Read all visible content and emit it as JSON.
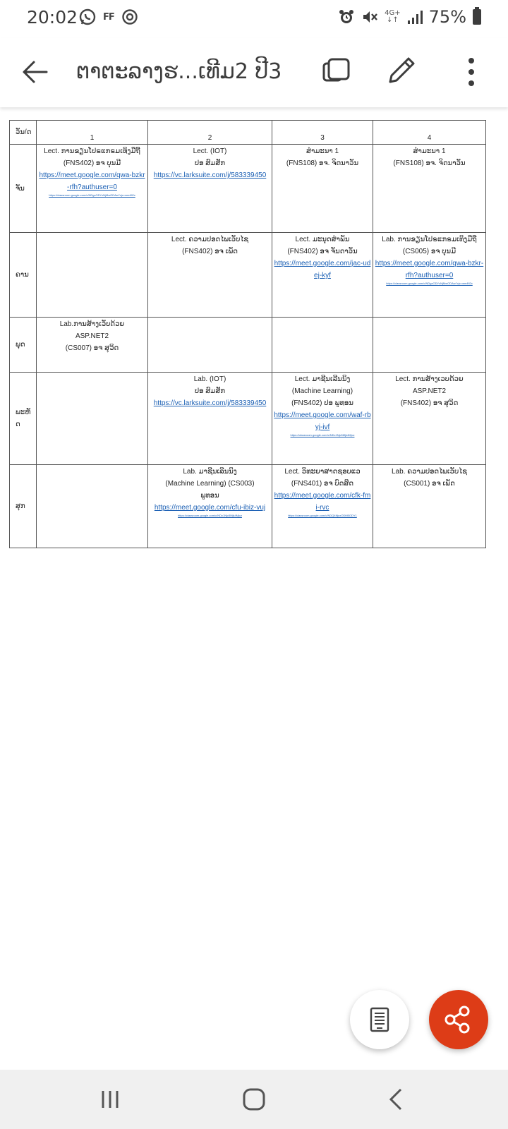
{
  "status_bar": {
    "time": "20:02",
    "ff_label": "FF",
    "network": "4G+",
    "battery": "75%",
    "icons": [
      "whatsapp-icon",
      "ff-icon",
      "sync-icon",
      "alarm-icon",
      "mute-icon",
      "signal-icon",
      "battery-icon"
    ]
  },
  "toolbar": {
    "title": "ຕາຕະລາງຮ...ເທີມ2 ປີ3",
    "icons": [
      "back-arrow-icon",
      "copy-icon",
      "edit-pencil-icon",
      "more-vert-icon"
    ]
  },
  "schedule": {
    "header": {
      "corner": "ວັນ/ດ",
      "periods": [
        "1",
        "2",
        "3",
        "4"
      ]
    },
    "rows": [
      {
        "day": "ຈັນ",
        "cells": [
          {
            "lines": [
              "Lect. ການຂຽນໂປຣແກຣມເທິງມືຖື",
              "(FNS402) ອຈ ບຸນມີ"
            ],
            "links": [
              "https://meet.google.com/qwa-bzkr-rfh?authuser=0"
            ],
            "tiny": [
              "https://classroom.google.com/c/NDgxODYzNjMwODAw?cjc=wm4fi2x"
            ]
          },
          {
            "lines": [
              "Lect. (IOT)",
              "ປອ ສົມສັກ"
            ],
            "links": [
              "https://vc.larksuite.com/j/583339450"
            ],
            "tiny": []
          },
          {
            "lines": [
              "ສຳມະນາ 1",
              "(FNS108) ອຈ. ຈິດນາວັນ"
            ],
            "links": [],
            "tiny": []
          },
          {
            "lines": [
              "ສຳມະນາ 1",
              "(FNS108) ອຈ. ຈິດນາວັນ"
            ],
            "links": [],
            "tiny": []
          }
        ]
      },
      {
        "day": "ຄານ",
        "cells": [
          {
            "lines": [],
            "links": [],
            "tiny": []
          },
          {
            "lines": [
              "Lect. ຄວາມປອດໄພເວັບໄຊ",
              "(FNS402) ອຈ ເພັດ"
            ],
            "links": [],
            "tiny": []
          },
          {
            "lines": [
              "Lect. ມະນຸດສຳພັນ",
              "(FNS402) ອຈ ຈັນດາວັນ"
            ],
            "links": [
              "https://meet.google.com/jac-udej-kyf"
            ],
            "tiny": []
          },
          {
            "lines": [
              "Lab. ການຂຽນໂປຣແກຣມເທິງມືຖື",
              "(CS005) ອຈ ບຸນມີ"
            ],
            "links": [
              "https://meet.google.com/qwa-bzkr-rfh?authuser=0"
            ],
            "tiny": [
              "https://classroom.google.com/c/NDgxODYzNjMwODAw?cjc=wm4fi2x"
            ]
          }
        ]
      },
      {
        "day": "ພຸດ",
        "cells": [
          {
            "lines": [
              "Lab.ການສ້າງເວັບດ້ວຍ",
              "ASP.NET2",
              "(CS007) ອຈ ສຸວິດ"
            ],
            "links": [],
            "tiny": []
          },
          {
            "lines": [],
            "links": [],
            "tiny": []
          },
          {
            "lines": [],
            "links": [],
            "tiny": []
          },
          {
            "lines": [],
            "links": [],
            "tiny": []
          }
        ]
      },
      {
        "day": "ພະຫັດ",
        "cells": [
          {
            "lines": [],
            "links": [],
            "tiny": []
          },
          {
            "lines": [
              "Lab. (IOT)",
              "ປອ ສົມສັກ"
            ],
            "links": [
              "https://vc.larksuite.com/j/583339450"
            ],
            "tiny": []
          },
          {
            "lines": [
              "Lect. ມາຊີນເລີນນິງ",
              "(Machine Learning)",
              "(FNS402) ປອ ພູທອນ"
            ],
            "links": [
              "https://meet.google.com/waf-rbyj-ivf"
            ],
            "tiny": [
              "https://classroom.google.com/c/NDc1Njc5Mjk4Mjcz"
            ]
          },
          {
            "lines": [
              "Lect. ການສ້າງເວບດ້ວຍ",
              "ASP.NET2",
              "(FNS402) ອຈ ສຸວິດ"
            ],
            "links": [],
            "tiny": []
          }
        ]
      },
      {
        "day": "ສຸກ",
        "cells": [
          {
            "lines": [],
            "links": [],
            "tiny": []
          },
          {
            "lines": [
              "Lab. ມາຊີນເລີນນິງ",
              "(Machine Learning) (CS003)",
              "ພູທອນ"
            ],
            "links": [
              "https://meet.google.com/cfu-ibiz-vuj"
            ],
            "tiny": [
              "https://classroom.google.com/c/NDc1Njc5Mjk4Mjcz"
            ]
          },
          {
            "lines": [
              "Lect. ວິທະຍາສາດຊອບແວ",
              "(FNS401) ອຈ ບົດສິດ"
            ],
            "links": [
              "https://meet.google.com/cfk-fmi-rvc"
            ],
            "tiny": [
              "https://classroom.google.com/c/NDQ4NjcxODM5ODY1"
            ]
          },
          {
            "lines": [
              "Lab. ຄວາມປອດໄພເວັບໄຊ",
              "(CS001) ອຈ ເພັດ"
            ],
            "links": [],
            "tiny": []
          }
        ]
      }
    ]
  },
  "fabs": {
    "icons": [
      "document-view-icon",
      "share-icon"
    ],
    "share_color": "#dd3c17"
  },
  "nav_bar": {
    "icons": [
      "recent-apps-icon",
      "home-icon",
      "back-icon"
    ]
  }
}
